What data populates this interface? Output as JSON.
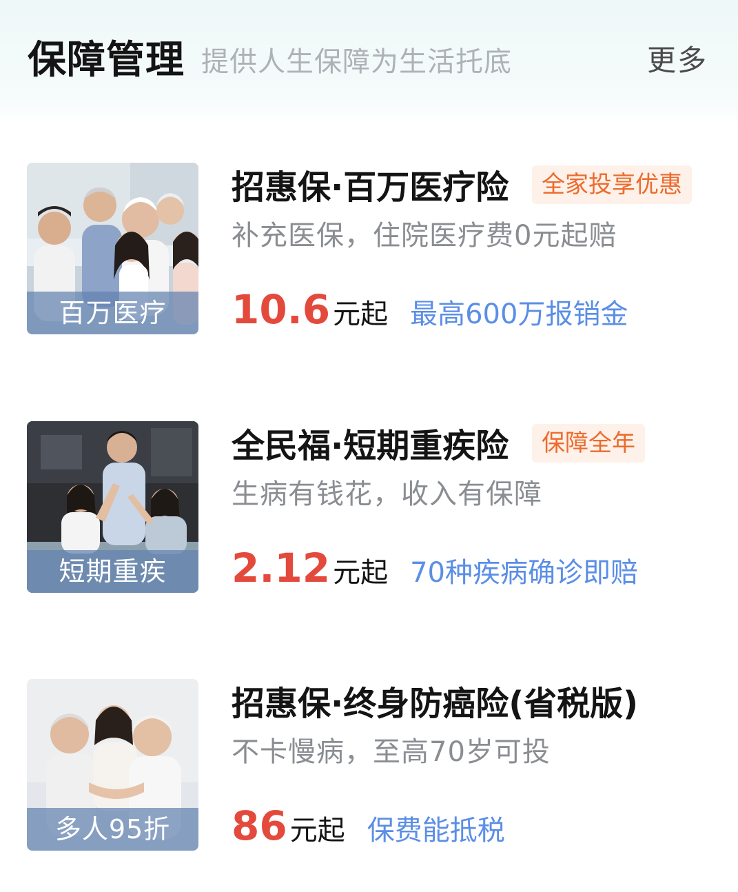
{
  "header": {
    "title": "保障管理",
    "subtitle": "提供人生保障为生活托底",
    "more_label": "更多"
  },
  "colors": {
    "price": "#e34a3c",
    "highlight": "#5b8ee6",
    "tag_text": "#ec6b2d",
    "tag_bg": "#fdf1e9"
  },
  "products": [
    {
      "thumb_caption": "百万医疗",
      "title": "招惠保·百万医疗险",
      "tag": "全家投享优惠",
      "desc": "补充医保，住院医疗费0元起赔",
      "price": "10.6",
      "price_unit": "元起",
      "highlight": "最高600万报销金"
    },
    {
      "thumb_caption": "短期重疾",
      "title": "全民福·短期重疾险",
      "tag": "保障全年",
      "desc": "生病有钱花，收入有保障",
      "price": "2.12",
      "price_unit": "元起",
      "highlight": "70种疾病确诊即赔"
    },
    {
      "thumb_caption": "多人95折",
      "title": "招惠保·终身防癌险(省税版)",
      "desc": "不卡慢病，至高70岁可投",
      "price": "86",
      "price_unit": "元起",
      "highlight": "保费能抵税"
    }
  ]
}
